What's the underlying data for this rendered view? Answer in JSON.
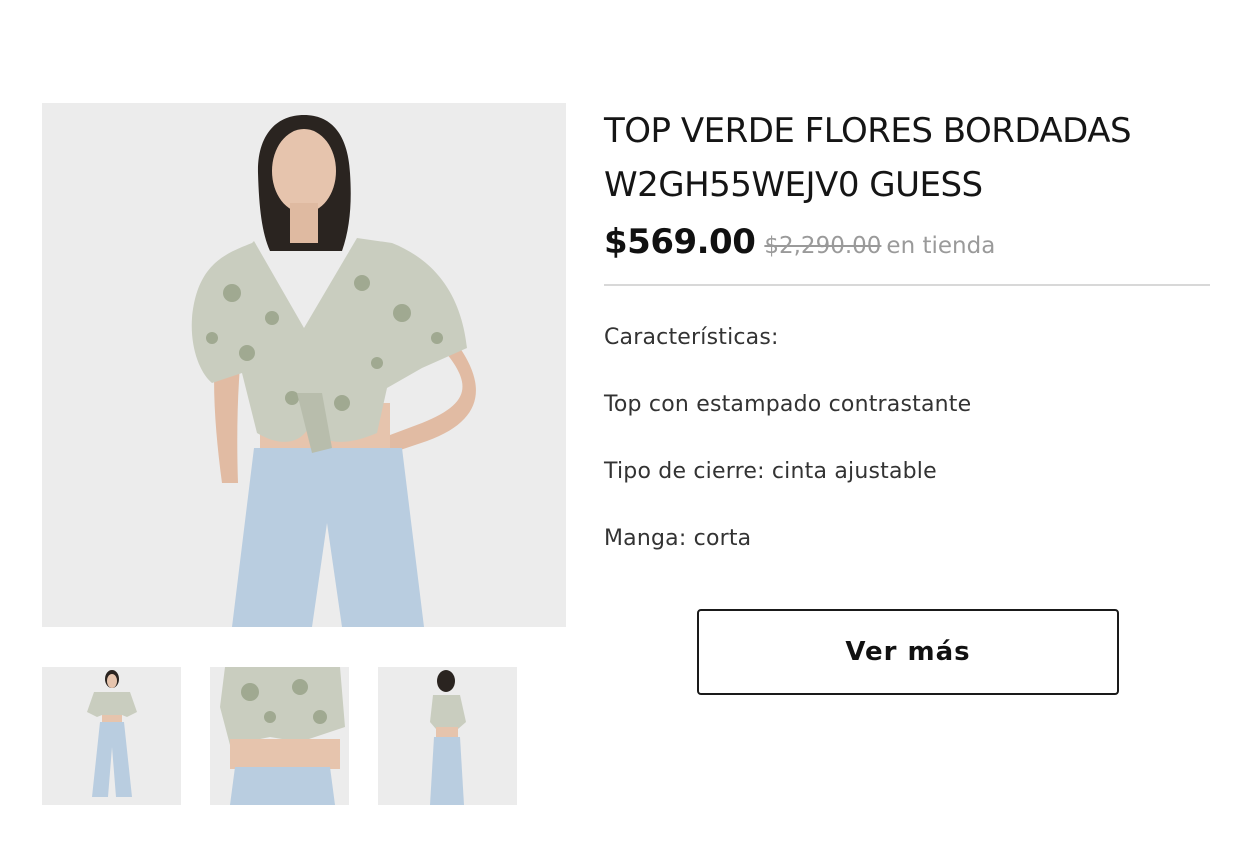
{
  "product": {
    "title_line1": "TOP VERDE FLORES BORDADAS",
    "title_line2": "W2GH55WEJV0 GUESS",
    "price": "$569.00",
    "old_price": "$2,290.00",
    "store_note": "en tienda"
  },
  "details": {
    "heading": "Características:",
    "lines": [
      "Top con estampado contrastante",
      "Tipo de cierre: cinta ajustable",
      "Manga: corta"
    ]
  },
  "actions": {
    "more_label": "Ver más"
  },
  "gallery": {
    "main_image": "product-model-front-photo",
    "thumbnails": [
      "thumbnail-front-full",
      "thumbnail-detail-closeup",
      "thumbnail-back-view"
    ]
  },
  "colors": {
    "background": "#ffffff",
    "photo_background": "#ececec",
    "old_price": "#9a9a9a",
    "divider": "#d8d8d8",
    "button_border": "#1a1a1a",
    "top_fabric": "#c9cdbf",
    "jeans": "#b9cde0"
  }
}
